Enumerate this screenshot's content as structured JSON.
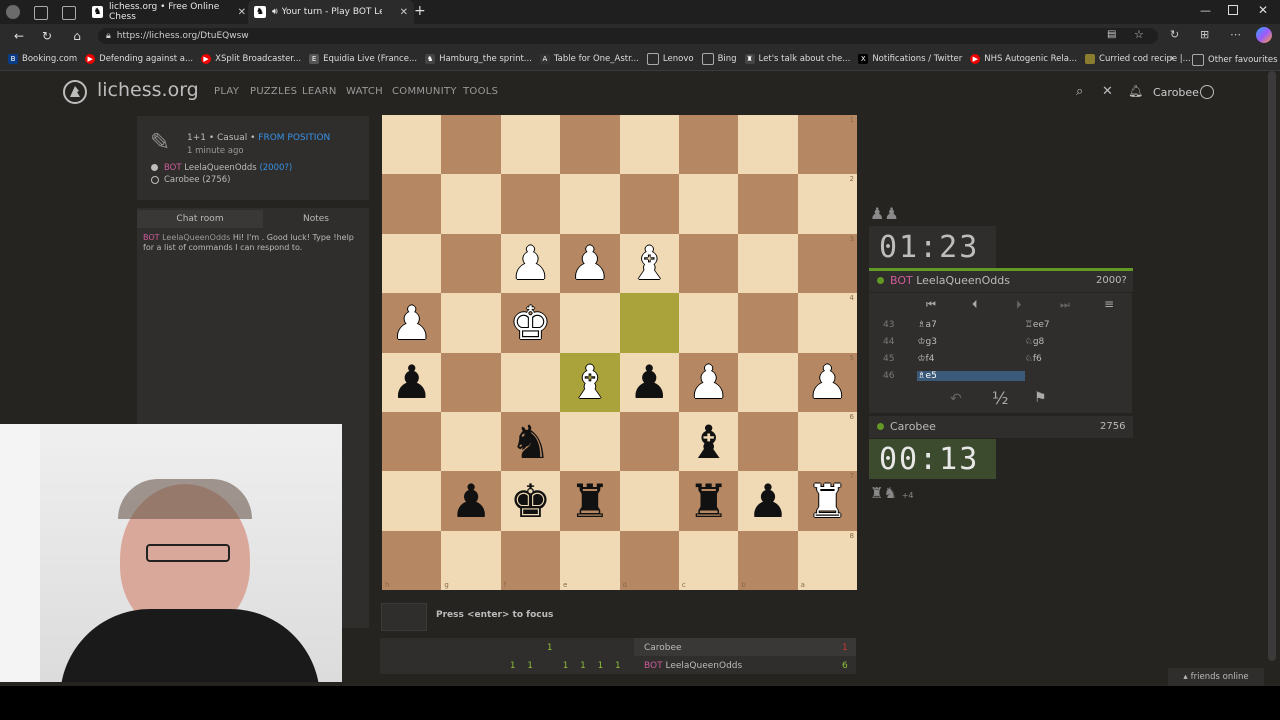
{
  "browser": {
    "tabs": [
      {
        "label": "lichess.org • Free Online Chess",
        "active": false
      },
      {
        "label": "Your turn - Play BOT LeelaQ...",
        "active": true
      }
    ],
    "url": "https://lichess.org/DtuEQwsw",
    "bookmarks": [
      "Booking.com",
      "Defending against a...",
      "XSplit Broadcaster...",
      "Equidia Live (France...",
      "Hamburg_the sprint...",
      "Table for One_Astr...",
      "Lenovo",
      "Bing",
      "Let's talk about che...",
      "Notifications / Twitter",
      "NHS Autogenic Rela...",
      "Curried cod recipe |..."
    ],
    "other_favourites": "Other favourites"
  },
  "site": {
    "logo": "lichess.org",
    "nav": [
      "PLAY",
      "PUZZLES",
      "LEARN",
      "WATCH",
      "COMMUNITY",
      "TOOLS"
    ],
    "username": "Carobee"
  },
  "game_meta": {
    "mode": "1+1 • Casual •",
    "from_position": "FROM POSITION",
    "time_ago": "1 minute ago",
    "bot_tag": "BOT",
    "player1": "LeelaQueenOdds",
    "player1_rating": "(2000?)",
    "player2": "Carobee (2756)"
  },
  "chat": {
    "tabs": [
      "Chat room",
      "Notes"
    ],
    "message_bot_tag": "BOT",
    "message_user": "LeelaQueenOdds",
    "message_text": "Hi! I'm . Good luck! Type !help for a list of commands I can respond to."
  },
  "board": {
    "ranks_label": [
      "1",
      "2",
      "3",
      "4",
      "5",
      "6",
      "7",
      "8"
    ],
    "files_label": [
      "h",
      "g",
      "f",
      "e",
      "d",
      "c",
      "b",
      "a"
    ],
    "rows": [
      [
        "",
        "",
        "",
        "",
        "",
        "",
        "",
        ""
      ],
      [
        "",
        "",
        "",
        "",
        "",
        "",
        "",
        ""
      ],
      [
        "",
        "",
        "wP",
        "wP",
        "wB",
        "",
        "",
        ""
      ],
      [
        "wP",
        "",
        "wK",
        "",
        "",
        "",
        "",
        ""
      ],
      [
        "bP",
        "",
        "",
        "wB",
        "bP",
        "wP",
        "",
        "wP"
      ],
      [
        "",
        "",
        "bN",
        "",
        "",
        "bB",
        "",
        ""
      ],
      [
        "",
        "bP",
        "bK",
        "bR",
        "",
        "bR",
        "bP",
        "wR"
      ],
      [
        "",
        "",
        "",
        "",
        "",
        "",
        "",
        ""
      ]
    ],
    "highlight": [
      [
        3,
        4
      ],
      [
        4,
        3
      ]
    ]
  },
  "panel": {
    "captured_top": "♟♟",
    "clock_top": "01:23",
    "top_bot_tag": "BOT",
    "top_player": "LeelaQueenOdds",
    "top_rating": "2000?",
    "moves": [
      {
        "num": "43",
        "w": "♗a7",
        "b": "♖ee7"
      },
      {
        "num": "44",
        "w": "♔g3",
        "b": "♘g8"
      },
      {
        "num": "45",
        "w": "♔f4",
        "b": "♘f6"
      },
      {
        "num": "46",
        "w": "♗e5",
        "b": ""
      }
    ],
    "draw_label": "½",
    "bottom_player": "Carobee",
    "bottom_rating": "2756",
    "clock_bottom": "00:13",
    "captured_bottom": "♜♞",
    "captured_bottom_extra": "+4"
  },
  "focus": {
    "text": "Press <enter> to focus"
  },
  "crosstable": {
    "top_scores": [
      "1"
    ],
    "bottom_scores": [
      "1",
      "1",
      "1",
      "1",
      "1",
      "1"
    ],
    "player_top": "Carobee",
    "player_top_score": "1",
    "bot_tag": "BOT",
    "player_bottom": "LeelaQueenOdds",
    "player_bottom_score": "6"
  },
  "friends": "friends online",
  "colors": {
    "bg": "#262421",
    "light_sq": "#f0d9b5",
    "dark_sq": "#b58863",
    "accent_blue": "#3692e7",
    "bot_pink": "#cd5c9a",
    "online_green": "#629924"
  }
}
